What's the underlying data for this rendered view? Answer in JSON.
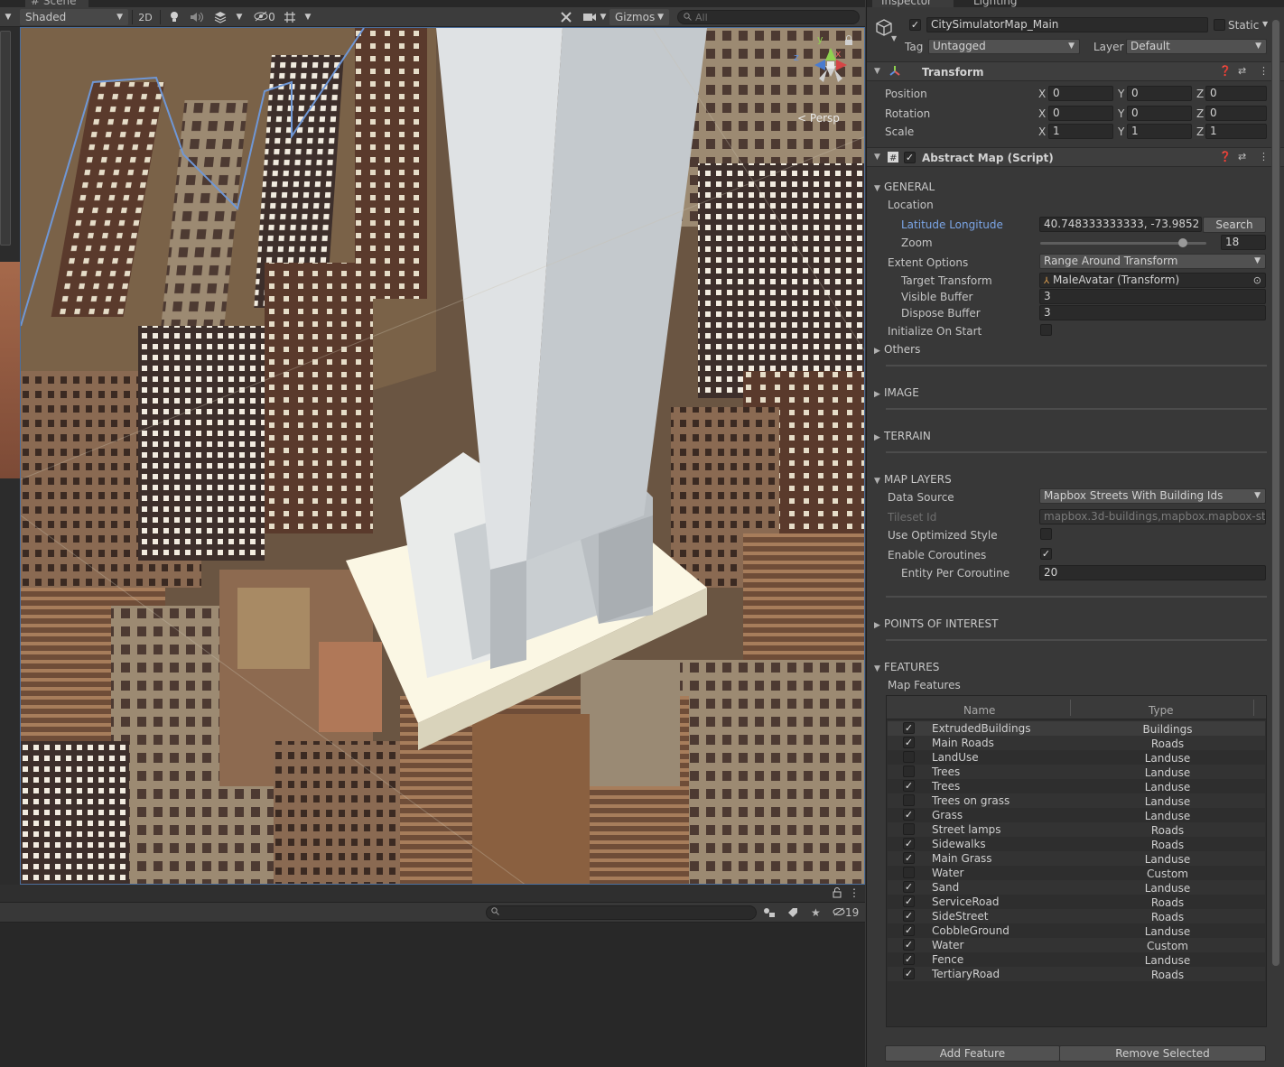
{
  "scene": {
    "tab_label": "# Scene",
    "shading_mode": "Shaded",
    "btn_2d": "2D",
    "hidden_count": "0",
    "gizmos_label": "Gizmos",
    "search_placeholder": "All",
    "persp_label": "Persp",
    "axis_y": "y",
    "axis_z": "z",
    "axis_x": "x"
  },
  "hierarchy": {
    "hidden_count": "19"
  },
  "inspector": {
    "tabs": [
      "Inspector",
      "Lighting"
    ],
    "object_name": "CitySimulatorMap_Main",
    "static_label": "Static",
    "tag_label": "Tag",
    "tag_value": "Untagged",
    "layer_label": "Layer",
    "layer_value": "Default",
    "transform": {
      "title": "Transform",
      "position_label": "Position",
      "rotation_label": "Rotation",
      "scale_label": "Scale",
      "axis_labels": [
        "X",
        "Y",
        "Z"
      ],
      "position": [
        "0",
        "0",
        "0"
      ],
      "rotation": [
        "0",
        "0",
        "0"
      ],
      "scale": [
        "1",
        "1",
        "1"
      ]
    },
    "abstract_map": {
      "title": "Abstract Map (Script)",
      "general": {
        "header": "GENERAL",
        "location_label": "Location",
        "latlon_label": "Latitude Longitude",
        "latlon_value": "40.748333333333, -73.9852",
        "search_label": "Search",
        "zoom_label": "Zoom",
        "zoom_value": "18",
        "zoom_fraction": 0.86,
        "extent_label": "Extent Options",
        "extent_value": "Range Around Transform",
        "target_label": "Target Transform",
        "target_value": "MaleAvatar (Transform)",
        "visible_buffer_label": "Visible Buffer",
        "visible_buffer_value": "3",
        "dispose_buffer_label": "Dispose Buffer",
        "dispose_buffer_value": "3",
        "init_label": "Initialize On Start",
        "others_label": "Others"
      },
      "image_header": "IMAGE",
      "terrain_header": "TERRAIN",
      "map_layers": {
        "header": "MAP LAYERS",
        "data_source_label": "Data Source",
        "data_source_value": "Mapbox Streets With Building Ids",
        "tileset_label": "Tileset Id",
        "tileset_value": "mapbox.3d-buildings,mapbox.mapbox-stree",
        "optimized_label": "Use Optimized Style",
        "coroutines_label": "Enable Coroutines",
        "entity_label": "Entity Per Coroutine",
        "entity_value": "20"
      },
      "poi_header": "POINTS OF INTEREST",
      "features": {
        "header": "FEATURES",
        "map_features_label": "Map Features",
        "col_name": "Name",
        "col_type": "Type",
        "rows": [
          {
            "name": "ExtrudedBuildings",
            "type": "Buildings",
            "checked": true
          },
          {
            "name": "Main Roads",
            "type": "Roads",
            "checked": true
          },
          {
            "name": "LandUse",
            "type": "Landuse",
            "checked": false
          },
          {
            "name": "Trees",
            "type": "Landuse",
            "checked": false
          },
          {
            "name": "Trees",
            "type": "Landuse",
            "checked": true
          },
          {
            "name": "Trees on grass",
            "type": "Landuse",
            "checked": false
          },
          {
            "name": "Grass",
            "type": "Landuse",
            "checked": true
          },
          {
            "name": "Street lamps",
            "type": "Roads",
            "checked": false
          },
          {
            "name": "Sidewalks",
            "type": "Roads",
            "checked": true
          },
          {
            "name": "Main Grass",
            "type": "Landuse",
            "checked": true
          },
          {
            "name": "Water",
            "type": "Custom",
            "checked": false
          },
          {
            "name": "Sand",
            "type": "Landuse",
            "checked": true
          },
          {
            "name": "ServiceRoad",
            "type": "Roads",
            "checked": true
          },
          {
            "name": "SideStreet",
            "type": "Roads",
            "checked": true
          },
          {
            "name": "CobbleGround",
            "type": "Landuse",
            "checked": true
          },
          {
            "name": "Water",
            "type": "Custom",
            "checked": true
          },
          {
            "name": "Fence",
            "type": "Landuse",
            "checked": true
          },
          {
            "name": "TertiaryRoad",
            "type": "Roads",
            "checked": true
          }
        ],
        "add_label": "Add Feature",
        "remove_label": "Remove Selected"
      }
    }
  }
}
